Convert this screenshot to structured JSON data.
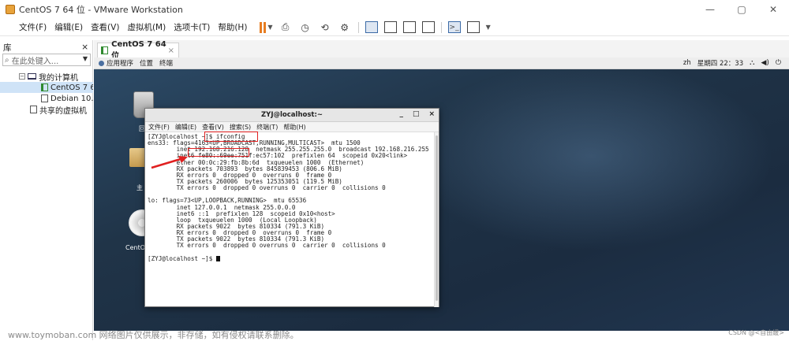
{
  "window": {
    "title": "CentOS 7 64 位 - VMware Workstation",
    "minimize": "—",
    "maximize": "▢",
    "close": "✕"
  },
  "menu": [
    "文件(F)",
    "编辑(E)",
    "查看(V)",
    "虚拟机(M)",
    "选项卡(T)",
    "帮助(H)"
  ],
  "library": {
    "title": "库",
    "close": "×",
    "search_placeholder": "在此处键入...",
    "tree": {
      "root": "我的计算机",
      "vms": [
        "CentOS 7 64",
        "Debian 10.x"
      ],
      "shared": "共享的虚拟机"
    }
  },
  "vm_tab": {
    "label": "CentOS 7 64 位",
    "close": "×"
  },
  "gnome_bar": {
    "apps": "应用程序",
    "places": "位置",
    "terminal": "终端",
    "lang": "zh",
    "clock": "星期四 22：33"
  },
  "desktop": {
    "label_home": "主",
    "label_trash": "回",
    "label_disc": "CentOS"
  },
  "terminal": {
    "title": "ZYJ@localhost:~",
    "menu": [
      "文件(F)",
      "编辑(E)",
      "查看(V)",
      "搜索(S)",
      "终端(T)",
      "帮助(H)"
    ],
    "min": "_",
    "max": "□",
    "close": "×",
    "lines": [
      "[ZYJ@localhost ~]$ ifconfig",
      "ens33: flags=4163<UP,BROADCAST,RUNNING,MULTICAST>  mtu 1500",
      "        inet 192.168.216.128  netmask 255.255.255.0  broadcast 192.168.216.255",
      "        inet6 fe80::69ee:751f:ec57:102  prefixlen 64  scopeid 0x20<link>",
      "        ether 00:0c:29:fb:8b:6d  txqueuelen 1000  (Ethernet)",
      "        RX packets 703893  bytes 845839453 (806.6 MiB)",
      "        RX errors 0  dropped 0  overruns 0  frame 0",
      "        TX packets 260006  bytes 125353051 (119.5 MiB)",
      "        TX errors 0  dropped 0 overruns 0  carrier 0  collisions 0",
      "",
      "lo: flags=73<UP,LOOPBACK,RUNNING>  mtu 65536",
      "        inet 127.0.0.1  netmask 255.0.0.0",
      "        inet6 ::1  prefixlen 128  scopeid 0x10<host>",
      "        loop  txqueuelen 1000  (Local Loopback)",
      "        RX packets 9022  bytes 810334 (791.3 KiB)",
      "        RX errors 0  dropped 0  overruns 0  frame 0",
      "        TX packets 9022  bytes 810334 (791.3 KiB)",
      "        TX errors 0  dropped 0 overruns 0  carrier 0  collisions 0",
      "",
      "[ZYJ@localhost ~]$ "
    ]
  },
  "watermark": "www.toymoban.com 网络图片仅供展示，非存储，如有侵权请联系删除。",
  "watermark_right": "CSDN @<自由媛>"
}
